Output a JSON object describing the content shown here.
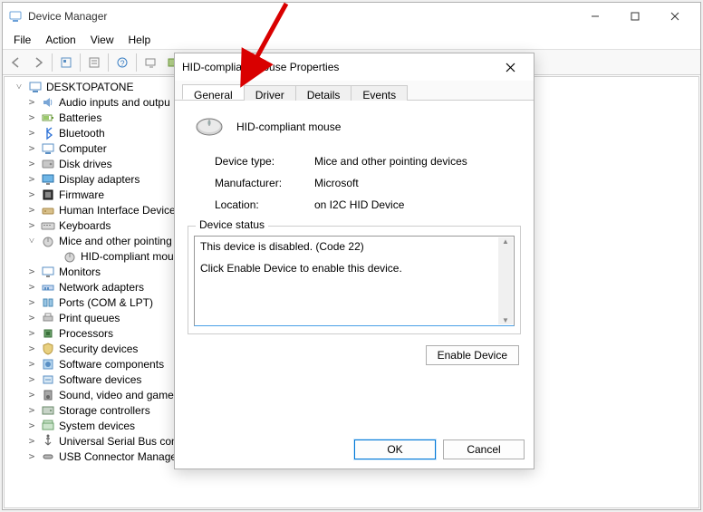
{
  "dm": {
    "title": "Device Manager",
    "menus": {
      "file": "File",
      "action": "Action",
      "view": "View",
      "help": "Help"
    },
    "tree": {
      "root": "DESKTOPATONE",
      "items": [
        {
          "label": "Audio inputs and outpu"
        },
        {
          "label": "Batteries"
        },
        {
          "label": "Bluetooth"
        },
        {
          "label": "Computer"
        },
        {
          "label": "Disk drives"
        },
        {
          "label": "Display adapters"
        },
        {
          "label": "Firmware"
        },
        {
          "label": "Human Interface Device"
        },
        {
          "label": "Keyboards"
        },
        {
          "label": "Mice and other pointing",
          "expanded": true,
          "children": [
            {
              "label": "HID-compliant mou"
            }
          ]
        },
        {
          "label": "Monitors"
        },
        {
          "label": "Network adapters"
        },
        {
          "label": "Ports (COM & LPT)"
        },
        {
          "label": "Print queues"
        },
        {
          "label": "Processors"
        },
        {
          "label": "Security devices"
        },
        {
          "label": "Software components"
        },
        {
          "label": "Software devices"
        },
        {
          "label": "Sound, video and game"
        },
        {
          "label": "Storage controllers"
        },
        {
          "label": "System devices"
        },
        {
          "label": "Universal Serial Bus cont."
        },
        {
          "label": "USB Connector Managers"
        }
      ]
    }
  },
  "props": {
    "title": "HID-compliant Mouse Properties",
    "tabs": {
      "general": "General",
      "driver": "Driver",
      "details": "Details",
      "events": "Events"
    },
    "device_name": "HID-compliant mouse",
    "labels": {
      "device_type": "Device type:",
      "manufacturer": "Manufacturer:",
      "location": "Location:",
      "status_group": "Device status"
    },
    "values": {
      "device_type": "Mice and other pointing devices",
      "manufacturer": "Microsoft",
      "location": "on I2C HID Device"
    },
    "status_line1": "This device is disabled. (Code 22)",
    "status_line2": "Click Enable Device to enable this device.",
    "buttons": {
      "enable_device": "Enable Device",
      "ok": "OK",
      "cancel": "Cancel"
    }
  }
}
